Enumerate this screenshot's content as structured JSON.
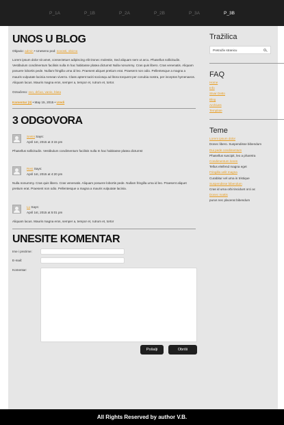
{
  "nav": {
    "items": [
      "P_1A",
      "P_1B",
      "P_2A",
      "P_2B",
      "P_3A",
      "P_3B"
    ],
    "active_index": 5
  },
  "post": {
    "title": "UNOS U BLOG",
    "meta_prefix": "Objavio:",
    "author": "admin",
    "meta_middle": "• Uneseno pod:",
    "categories": "novosti, obicno",
    "body": "Lorem ipsum dolor sit amet, consectetuer adipiscing elit Donec molestie, Sed aliquam sem ut arcu. Phasellus sollicitudin. Vestibulum condimentum facilisis nulla In hac habitasse platea dictumst Nulla nonummy. Cras quis libero. Cras venenatis. Aliquam posuere lobortis pede. Nullam fringilla urna id leo. Praesent aliquet pretium erat. Praesent non odio. Pellentesque a magna a mauris vulputate lacinia Aenean viverra. Class aptent taciti sociosqu ad litora torquent per conubia nostra, per inceptos hymenaeos. Aliquam lacus. Mauris magna eros, semper a, tempor et, rutrum et, tortor.",
    "tags_label": "Označeno:",
    "tags": "ovo, drčuo, vanio, blata",
    "comments_link": "Komentar (3)",
    "date": "• May 15, 2015 •",
    "edit_link": "Uredi"
  },
  "comments": {
    "heading": "3 ODGOVORA",
    "items": [
      {
        "author": "Sretni",
        "says": "Says:",
        "date": "April 1st, 2015 at 3:15 pm",
        "text": "Phasellus sollicitudin. Vestibulum condimentum facilisis nulla In hac habitasse platea dictumst"
      },
      {
        "author": "Reni",
        "says": "Says:",
        "date": "April 1st, 2015 at 4:20 pm",
        "text": "Nulla nonummy. Cras quis libero. Cras venenatis. Aliquam posuere lobortis pede. Nullam fringilla urna id leo. Praesent aliquet pretium erat. Praesent non odio. Pellentesque a magna a mauris vulputate lacinia."
      },
      {
        "author": "Lu",
        "says": "Says:",
        "date": "April 1st, 2015 at 5:01 pm",
        "text": "Aliquam lacus. Mauris magna eros, semper a, tempor et, rutrum et, tortor"
      }
    ]
  },
  "form": {
    "heading": "UNESITE KOMENTAR",
    "name_label": "Ime i prezime:",
    "email_label": "E-mail:",
    "comment_label": "Komentar:",
    "submit": "Pošalji",
    "reset": "Obriši"
  },
  "sidebar": {
    "search_title": "Tražilica",
    "search_placeholder": "Pretraživ stranicu",
    "faq_title": "FAQ",
    "faq_links": [
      "Home",
      "Info",
      "Stvar Detto",
      "Blog",
      "Archives",
      "Template"
    ],
    "teme_title": "Teme",
    "teme": [
      {
        "title": "Lorem ipsum dolor",
        "desc": "Donec libero. Suspendisse bibendum"
      },
      {
        "title": "Dui pede condimentum",
        "desc": "Phasellus suscipit, leo a pharetra"
      },
      {
        "title": "Condimentum lorem",
        "desc": "Tellus eleifend magna eget"
      },
      {
        "title": "Fringilla velit magna",
        "desc": "Curabitur vel urna in tristique"
      },
      {
        "title": "Suspendisse bibendum",
        "desc": "Cras id urna orbi tincidunt orci ac"
      },
      {
        "title": "Donec mattis",
        "desc": "purus nec placerat bibendum"
      }
    ]
  },
  "footer": {
    "text": "All Rights Reserved by author V.B."
  },
  "colors": {
    "accent": "#e89c1e",
    "nav_bg": "#1f1f1f",
    "page_bg": "#e6e6e6",
    "footer_bg": "#000000"
  }
}
